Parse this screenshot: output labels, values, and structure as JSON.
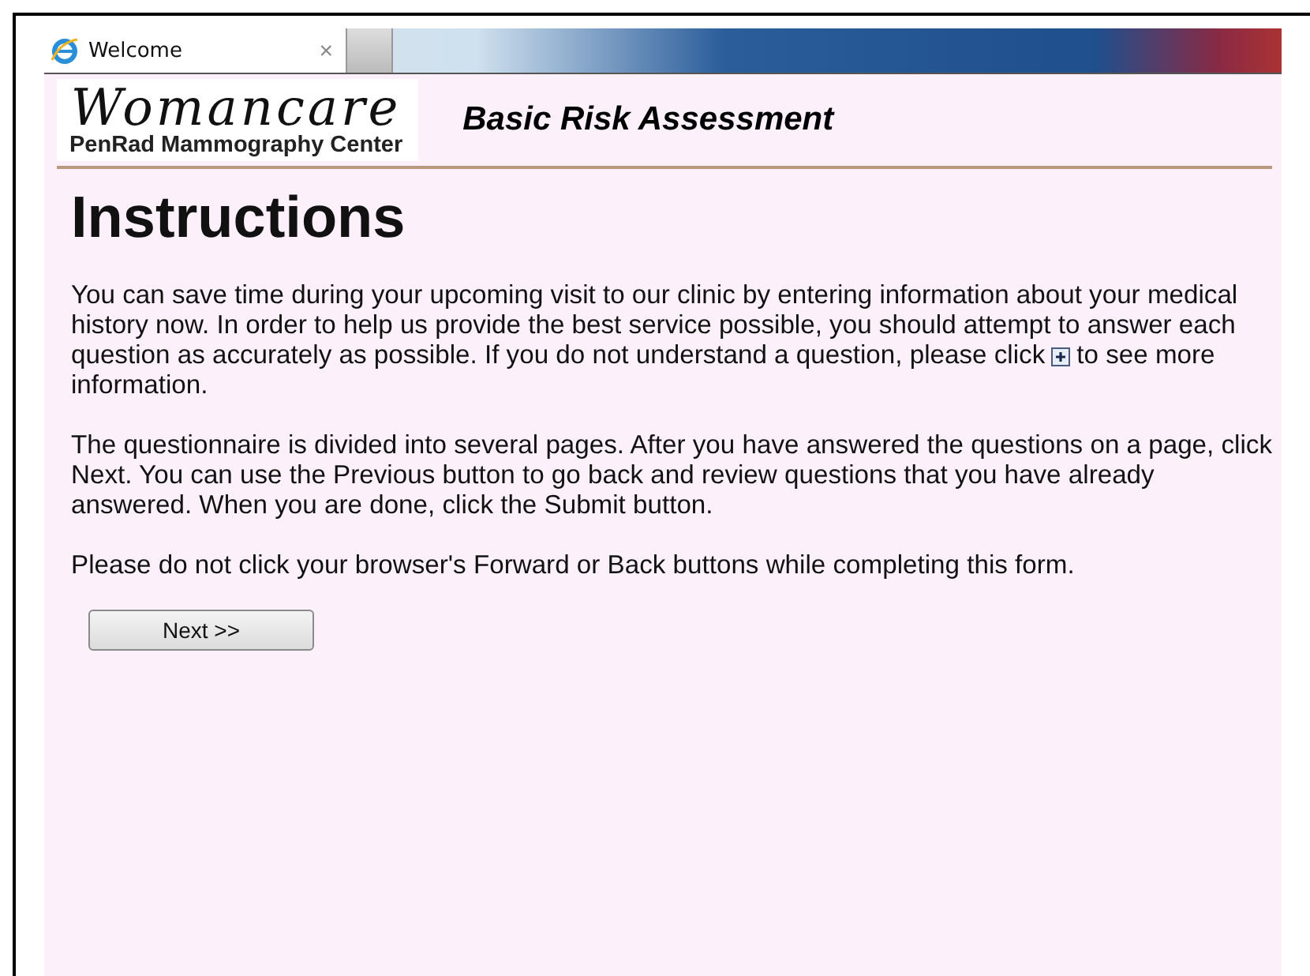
{
  "browser_tab": {
    "title": "Welcome",
    "close": "×"
  },
  "header": {
    "logo_name": "Womancare",
    "logo_subtitle": "PenRad Mammography Center",
    "title": "Basic Risk Assessment"
  },
  "heading": "Instructions",
  "paragraphs": [
    {
      "kind": "with_icon",
      "before": "You can save time during your upcoming visit to our clinic by entering information about your medical history now.  In order to help us provide the best service possible, you should attempt to answer each question as accurately as possible.  If you do not understand a question, please click",
      "after": "to see more information."
    },
    {
      "kind": "plain",
      "text": "The questionnaire is divided into several pages. After you have answered the questions on a page, click Next. You can use the Previous button to go back and review questions that you have already answered. When you are done, click the Submit button."
    },
    {
      "kind": "plain",
      "text": "Please do not click your browser's Forward or Back buttons while completing this form."
    }
  ],
  "next_button": "Next >>"
}
